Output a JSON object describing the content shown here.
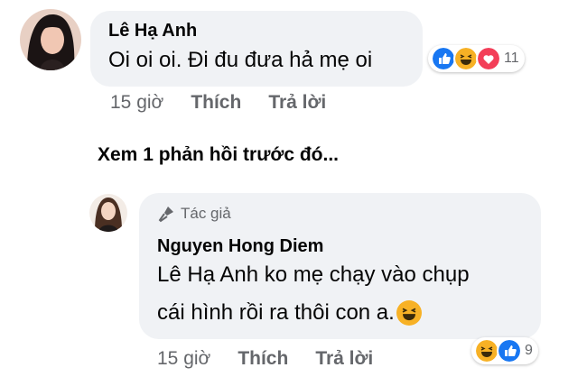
{
  "comment": {
    "author": "Lê Hạ Anh",
    "text": "Oi oi oi. Đi đu đưa hả mẹ oi",
    "time": "15 giờ",
    "like_label": "Thích",
    "reply_label": "Trả lời",
    "reaction_count": "11",
    "reactions": [
      "like-icon",
      "haha-icon",
      "love-icon"
    ]
  },
  "view_previous": "Xem 1 phản hồi trước đó...",
  "reply": {
    "badge": "Tác giả",
    "author": "Nguyen Hong Diem",
    "mention": "Lê Hạ Anh",
    "text_line1": " ko mẹ chạy vào chụp",
    "text_line2": "cái hình rồi ra thôi con a.",
    "time": "15 giờ",
    "like_label": "Thích",
    "reply_label": "Trả lời",
    "reaction_count": "9",
    "reactions": [
      "haha-icon",
      "like-icon"
    ]
  },
  "colors": {
    "bubble": "#f0f2f5",
    "like_blue": "#1877f2",
    "love_red": "#f33e58",
    "haha_yellow": "#f7b125",
    "meta_gray": "#65676b"
  }
}
